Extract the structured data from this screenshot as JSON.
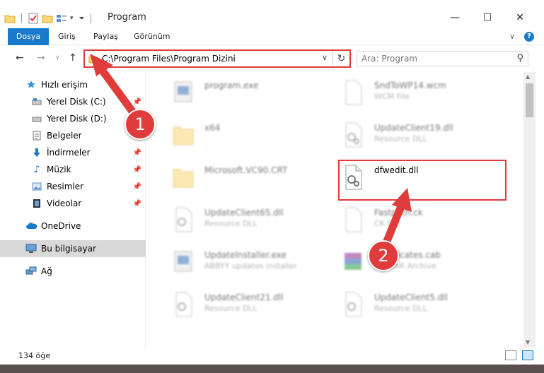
{
  "window": {
    "title": "Program",
    "minimize": "—",
    "maximize": "☐",
    "close": "✕"
  },
  "ribbon": {
    "tabs": [
      "Dosya",
      "Giriş",
      "Paylaş",
      "Görünüm"
    ],
    "collapse": "∨",
    "help": "?"
  },
  "address": {
    "path": "C:\\Program Files\\Program Dizini",
    "search_placeholder": "Ara: Program"
  },
  "navigation": {
    "items": [
      {
        "label": "Hızlı erişim",
        "icon": "star-icon"
      },
      {
        "label": "Yerel Disk (C:)",
        "icon": "drive-icon",
        "pinned": true
      },
      {
        "label": "Yerel Disk (D:)",
        "icon": "drive-icon"
      },
      {
        "label": "Belgeler",
        "icon": "document-icon"
      },
      {
        "label": "İndirmeler",
        "icon": "download-icon",
        "pinned": true
      },
      {
        "label": "Müzik",
        "icon": "music-icon",
        "pinned": true
      },
      {
        "label": "Resimler",
        "icon": "pictures-icon",
        "pinned": true
      },
      {
        "label": "Videolar",
        "icon": "video-icon",
        "pinned": true
      },
      {
        "label": "OneDrive",
        "icon": "cloud-icon"
      },
      {
        "label": "Bu bilgisayar",
        "icon": "computer-icon",
        "selected": true
      },
      {
        "label": "Ağ",
        "icon": "network-icon"
      }
    ]
  },
  "files": [
    {
      "name": "program.exe",
      "desc": "",
      "type": "exe"
    },
    {
      "name": "SndToWP14.wcm",
      "desc": "WCM File",
      "type": "file"
    },
    {
      "name": "x64",
      "desc": "",
      "type": "folder"
    },
    {
      "name": "UpdateClient19.dll",
      "desc": "Resource DLL",
      "type": "dll"
    },
    {
      "name": "Microsoft.VC90.CRT",
      "desc": "",
      "type": "folder"
    },
    {
      "name": "dfwedit.dll",
      "desc": "",
      "type": "dll",
      "highlighted": true
    },
    {
      "name": "UpdateClient65.dll",
      "desc": "Resource DLL",
      "type": "dll"
    },
    {
      "name": "Fastpath.ck",
      "desc": "CK File",
      "type": "file"
    },
    {
      "name": "UpdateInstaller.exe",
      "desc": "ABBYY updates installer",
      "type": "exe"
    },
    {
      "name": "Certificates.cab",
      "desc": "WinRAR Archive",
      "type": "archive"
    },
    {
      "name": "UpdateClient21.dll",
      "desc": "Resource DLL",
      "type": "dll"
    },
    {
      "name": "UpdateClient5.dll",
      "desc": "Resource DLL",
      "type": "dll"
    }
  ],
  "status": {
    "count": "134 öğe"
  },
  "callouts": [
    "1",
    "2"
  ],
  "colors": {
    "accent": "#1979ca",
    "highlight": "#e03c3c"
  }
}
